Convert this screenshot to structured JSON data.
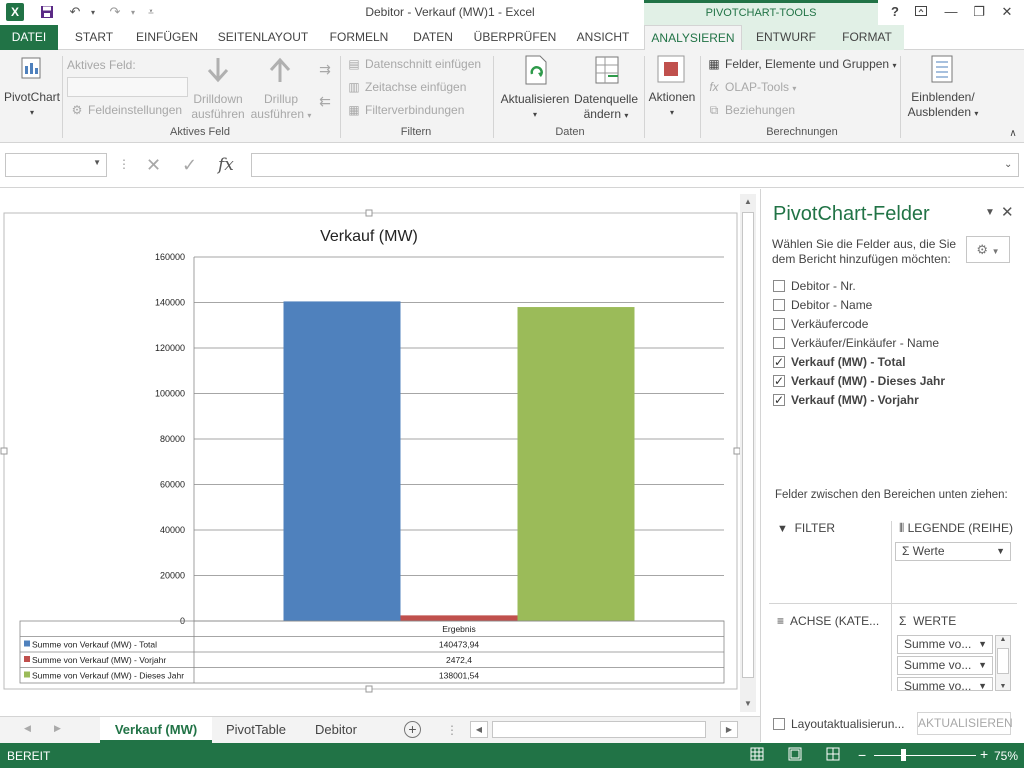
{
  "window": {
    "title": "Debitor - Verkauf (MW)1 - Excel",
    "contextual_tools": "PIVOTCHART-TOOLS",
    "help": "?"
  },
  "tabs": [
    {
      "label": "DATEI"
    },
    {
      "label": "START"
    },
    {
      "label": "EINFÜGEN"
    },
    {
      "label": "SEITENLAYOUT"
    },
    {
      "label": "FORMELN"
    },
    {
      "label": "DATEN"
    },
    {
      "label": "ÜBERPRÜFEN"
    },
    {
      "label": "ANSICHT"
    },
    {
      "label": "ANALYSIEREN"
    },
    {
      "label": "ENTWURF"
    },
    {
      "label": "FORMAT"
    }
  ],
  "ribbon": {
    "pivotchart": "PivotChart",
    "active_field_label": "Aktives Feld:",
    "field_settings": "Feldeinstellungen",
    "drilldown_1": "Drilldown",
    "drilldown_2": "ausführen",
    "drillup_1": "Drillup",
    "drillup_2": "ausführen",
    "group_active_field": "Aktives Feld",
    "insert_slicer": "Datenschnitt einfügen",
    "insert_timeline": "Zeitachse einfügen",
    "filter_connections": "Filterverbindungen",
    "group_filter": "Filtern",
    "refresh": "Aktualisieren",
    "change_source_1": "Datenquelle",
    "change_source_2": "ändern",
    "group_data": "Daten",
    "actions": "Aktionen",
    "fields_items_sets": "Felder, Elemente und Gruppen",
    "olap_tools": "OLAP-Tools",
    "relationships": "Beziehungen",
    "group_calculations": "Berechnungen",
    "show_hide_1": "Einblenden/",
    "show_hide_2": "Ausblenden"
  },
  "chart_data": {
    "type": "bar",
    "title": "Verkauf (MW)",
    "categories": [
      "Ergebnis"
    ],
    "ylim": [
      0,
      160000
    ],
    "yticks": [
      "0",
      "20000",
      "40000",
      "60000",
      "80000",
      "100000",
      "120000",
      "140000",
      "160000"
    ],
    "grid": true,
    "legend_placement": "data-table-below",
    "series": [
      {
        "name": "Summe von Verkauf (MW) - Total",
        "values": [
          140473.94
        ],
        "label": "140473,94",
        "color": "#4f81bd"
      },
      {
        "name": "Summe von Verkauf (MW) - Vorjahr",
        "values": [
          2472.4
        ],
        "label": "2472,4",
        "color": "#c0504d"
      },
      {
        "name": "Summe von Verkauf (MW) - Dieses Jahr",
        "values": [
          138001.54
        ],
        "label": "138001,54",
        "color": "#9bbb59"
      }
    ]
  },
  "fieldpane": {
    "title": "PivotChart-Felder",
    "subtitle_1": "Wählen Sie die Felder aus, die Sie",
    "subtitle_2": "dem Bericht hinzufügen möchten:",
    "fields": [
      {
        "label": "Debitor - Nr.",
        "checked": false
      },
      {
        "label": "Debitor - Name",
        "checked": false
      },
      {
        "label": "Verkäufercode",
        "checked": false
      },
      {
        "label": "Verkäufer/Einkäufer - Name",
        "checked": false
      },
      {
        "label": "Verkauf (MW) - Total",
        "checked": true
      },
      {
        "label": "Verkauf (MW) - Dieses Jahr",
        "checked": true
      },
      {
        "label": "Verkauf (MW) - Vorjahr",
        "checked": true
      }
    ],
    "drag_hint": "Felder zwischen den Bereichen unten ziehen:",
    "filter_zone": "FILTER",
    "legend_zone": "LEGENDE (REIHE)",
    "legend_item": "Werte",
    "axis_zone": "ACHSE (KATE...",
    "values_zone": "WERTE",
    "value_items": [
      "Summe vo...",
      "Summe vo...",
      "Summe vo..."
    ],
    "defer_update": "Layoutaktualisierun...",
    "update_button": "AKTUALISIEREN"
  },
  "sheets": [
    {
      "label": "Verkauf (MW)",
      "active": true
    },
    {
      "label": "PivotTable",
      "active": false
    },
    {
      "label": "Debitor",
      "active": false
    }
  ],
  "status": {
    "ready": "BEREIT",
    "zoom": "75%"
  }
}
